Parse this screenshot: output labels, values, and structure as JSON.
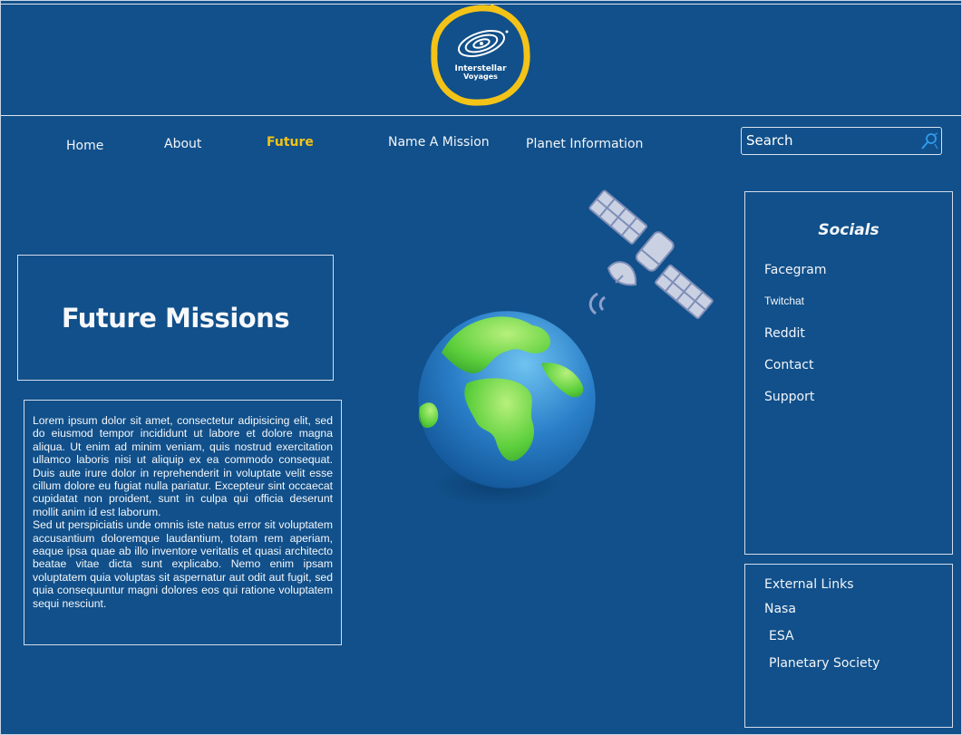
{
  "logo": {
    "line1": "Interstellar",
    "line2": "Voyages",
    "ring_color": "#f3c318"
  },
  "nav": {
    "items": [
      {
        "label": "Home",
        "active": false
      },
      {
        "label": "About",
        "active": false
      },
      {
        "label": "Future",
        "active": true
      },
      {
        "label": "Name A Mission",
        "active": false
      },
      {
        "label": "Planet Information",
        "active": false
      }
    ],
    "active_color": "#f3c318"
  },
  "search": {
    "placeholder": "Search",
    "icon": "search-icon"
  },
  "main": {
    "title": "Future Missions",
    "body": "Lorem ipsum dolor sit amet, consectetur adipisicing elit, sed do eiusmod tempor incididunt ut labore et dolore magna aliqua. Ut enim ad minim veniam, quis nostrud exercitation ullamco laboris nisi ut aliquip ex ea commodo consequat. Duis aute irure dolor in reprehenderit in voluptate velit esse cillum dolore eu fugiat nulla pariatur. Excepteur sint occaecat cupidatat non proident, sunt in culpa qui officia deserunt mollit anim id est laborum.\nSed ut perspiciatis unde omnis iste natus error sit voluptatem accusantium doloremque laudantium, totam rem aperiam, eaque ipsa quae ab illo inventore veritatis et quasi architecto beatae vitae dicta sunt explicabo. Nemo enim ipsam voluptatem quia voluptas sit aspernatur aut odit aut fugit, sed quia consequuntur magni dolores eos qui ratione voluptatem sequi nesciunt."
  },
  "illustrations": {
    "satellite": "satellite-icon",
    "globe": "earth-globe"
  },
  "socials": {
    "title": "Socials",
    "links": [
      "Facegram",
      "Twitchat",
      "Reddit",
      "Contact",
      "Support"
    ]
  },
  "external": {
    "heading": "External Links",
    "links": [
      "Nasa",
      "ESA",
      "Planetary Society"
    ]
  },
  "colors": {
    "background": "#11508a",
    "accent": "#f3c318",
    "globe_ocean": "#2a7fc9",
    "globe_land": "#5ccf3c"
  }
}
